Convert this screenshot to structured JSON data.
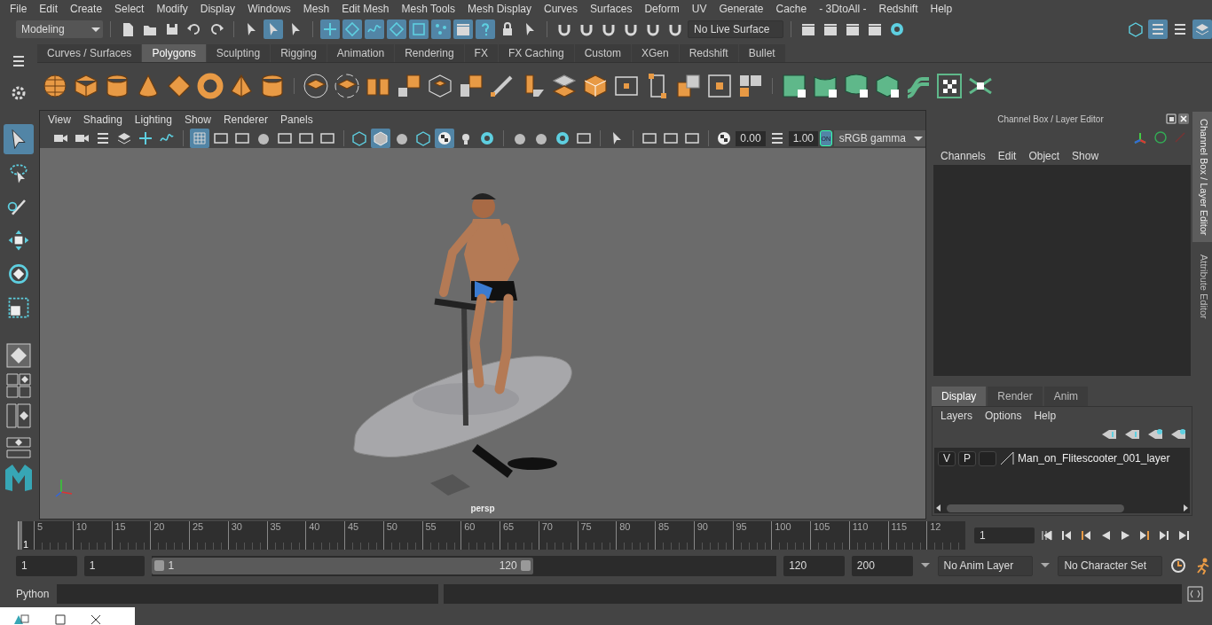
{
  "menubar": [
    "File",
    "Edit",
    "Create",
    "Select",
    "Modify",
    "Display",
    "Windows",
    "Mesh",
    "Edit Mesh",
    "Mesh Tools",
    "Mesh Display",
    "Curves",
    "Surfaces",
    "Deform",
    "UV",
    "Generate",
    "Cache",
    "- 3DtoAll -",
    "Redshift",
    "Help"
  ],
  "status_line": {
    "mode": "Modeling",
    "live_surface": "No Live Surface",
    "select_modes": [
      {
        "selected": false
      },
      {
        "selected": true
      },
      {
        "selected": false
      }
    ],
    "masks": [
      {
        "selected": true
      },
      {
        "selected": true
      },
      {
        "selected": true
      },
      {
        "selected": true
      },
      {
        "selected": true
      },
      {
        "selected": true
      },
      {
        "selected": true
      },
      {
        "selected": true
      }
    ],
    "panel_toggles": [
      {
        "selected": false
      },
      {
        "selected": true
      },
      {
        "selected": false
      },
      {
        "selected": true
      }
    ]
  },
  "shelf": {
    "tabs": [
      {
        "label": "Curves / Surfaces",
        "selected": false
      },
      {
        "label": "Polygons",
        "selected": true
      },
      {
        "label": "Sculpting",
        "selected": false
      },
      {
        "label": "Rigging",
        "selected": false
      },
      {
        "label": "Animation",
        "selected": false
      },
      {
        "label": "Rendering",
        "selected": false
      },
      {
        "label": "FX",
        "selected": false
      },
      {
        "label": "FX Caching",
        "selected": false
      },
      {
        "label": "Custom",
        "selected": false
      },
      {
        "label": "XGen",
        "selected": false
      },
      {
        "label": "Redshift",
        "selected": false
      },
      {
        "label": "Bullet",
        "selected": false
      }
    ]
  },
  "toolbox": {
    "tools": [
      {
        "selected": true
      },
      {
        "selected": false
      },
      {
        "selected": false
      },
      {
        "selected": false
      },
      {
        "selected": false
      },
      {
        "selected": false
      }
    ]
  },
  "viewport": {
    "menu": [
      "View",
      "Shading",
      "Lighting",
      "Show",
      "Renderer",
      "Panels"
    ],
    "toggles": [
      {
        "selected": false
      },
      {
        "selected": false
      },
      {
        "selected": false
      },
      {
        "selected": false
      },
      {
        "selected": false
      },
      {
        "selected": false
      },
      {
        "selected": true
      },
      {
        "selected": false
      },
      {
        "selected": false
      },
      {
        "selected": false
      },
      {
        "selected": false
      },
      {
        "selected": false
      },
      {
        "selected": false
      },
      {
        "selected": false
      },
      {
        "selected": true
      },
      {
        "selected": false
      },
      {
        "selected": false
      },
      {
        "selected": true
      },
      {
        "selected": false
      },
      {
        "selected": false
      }
    ],
    "exposure": "0.00",
    "gamma": "1.00",
    "color_management": {
      "label": "ON",
      "on": true
    },
    "view_transform": "sRGB gamma",
    "camera": "persp"
  },
  "channel_box": {
    "title": "Channel Box / Layer Editor",
    "menu": [
      "Channels",
      "Edit",
      "Object",
      "Show"
    ],
    "side_tabs": [
      {
        "label": "Channel Box / Layer Editor",
        "selected": true
      },
      {
        "label": "Attribute Editor",
        "selected": false
      }
    ],
    "layer_tabs": [
      {
        "label": "Display",
        "selected": true
      },
      {
        "label": "Render",
        "selected": false
      },
      {
        "label": "Anim",
        "selected": false
      }
    ],
    "layer_menu": [
      "Layers",
      "Options",
      "Help"
    ],
    "layers": [
      {
        "visibility": "V",
        "playback": "P",
        "name": "Man_on_Flitescooter_001_layer"
      }
    ]
  },
  "timeline": {
    "start_label": "1",
    "ticks": [
      "5",
      "10",
      "15",
      "20",
      "25",
      "30",
      "35",
      "40",
      "45",
      "50",
      "55",
      "60",
      "65",
      "70",
      "75",
      "80",
      "85",
      "90",
      "95",
      "100",
      "105",
      "110",
      "115",
      "12"
    ],
    "current_frame": "1",
    "level": 0
  },
  "range": {
    "start": "1",
    "playback_start": "1",
    "slider_start": "1",
    "slider_end": "120",
    "level": 0.61,
    "playback_end": "120",
    "end": "200",
    "anim_layer": "No Anim Layer",
    "character_set": "No Character Set"
  },
  "command_line": {
    "language": "Python"
  }
}
